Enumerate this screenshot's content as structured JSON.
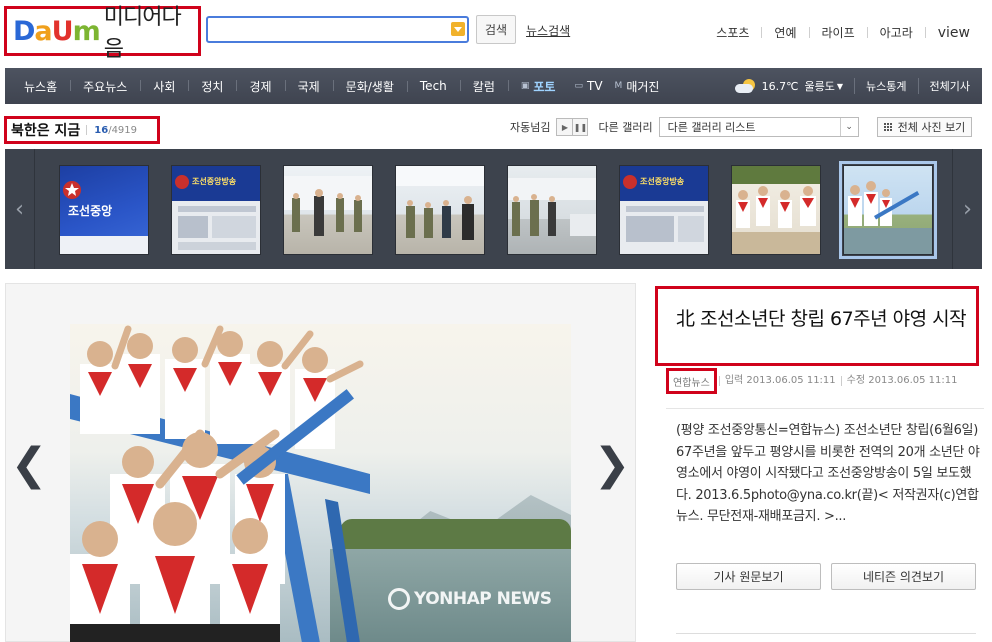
{
  "header": {
    "logo_letters": [
      "D",
      "a",
      "U",
      "m"
    ],
    "logo_text": "미디어다음",
    "search_placeholder": "",
    "search_button": "검색",
    "news_search_link": "뉴스검색",
    "top_links": [
      "스포츠",
      "연예",
      "라이프",
      "아고라",
      "view"
    ]
  },
  "nav": {
    "items": [
      "뉴스홈",
      "주요뉴스",
      "사회",
      "정치",
      "경제",
      "국제",
      "문화/생활",
      "Tech",
      "칼럼"
    ],
    "sub_items": [
      {
        "label": "포토",
        "icon": "camera-icon",
        "active": true
      },
      {
        "label": "TV",
        "icon": "tv-icon",
        "active": false
      },
      {
        "label": "매거진",
        "icon": "magazine-icon",
        "active": false
      }
    ],
    "weather": {
      "temp": "16.7℃",
      "region": "울릉도",
      "icon": "partly-cloudy-icon"
    },
    "right_links": [
      "뉴스통계",
      "전체기사"
    ]
  },
  "section": {
    "title": "북한은 지금",
    "current": "16",
    "total": "/4919"
  },
  "toolbar": {
    "autoplay_label": "자동넘김",
    "gallery_label": "다른 갤러리",
    "gallery_select_value": "다른 갤러리 리스트",
    "all_photos_button": "전체 사진 보기"
  },
  "thumbnails": [
    {
      "scene": "tv-blue",
      "caption": "조선중앙"
    },
    {
      "scene": "tv-web",
      "caption": "조선중앙방송"
    },
    {
      "scene": "factory",
      "caption": ""
    },
    {
      "scene": "factory",
      "caption": ""
    },
    {
      "scene": "lab",
      "caption": ""
    },
    {
      "scene": "tv-web",
      "caption": "조선중앙방송"
    },
    {
      "scene": "kids",
      "caption": ""
    },
    {
      "scene": "kids2",
      "caption": "",
      "selected": true
    }
  ],
  "photo": {
    "watermark": "YONHAP NEWS"
  },
  "article": {
    "title": "北 조선소년단 창립 67주년 야영 시작",
    "source": "연합뉴스",
    "input_time": "입력 2013.06.05 11:11",
    "edit_time": "수정 2013.06.05 11:11",
    "body": "(평양 조선중앙통신=연합뉴스) 조선소년단 창립(6월6일) 67주년을 앞두고 평양시를 비롯한 전역의 20개 소년단 야영소에서 야영이 시작됐다고 조선중앙방송이 5일 보도했다. 2013.6.5photo@yna.co.kr(끝)< 저작권자(c)연합뉴스. 무단전재-재배포금지. >...",
    "buttons": [
      "기사 원문보기",
      "네티즌 의견보기"
    ]
  },
  "colors": {
    "nav_bg": "#444a55",
    "highlight_red": "#d0021b",
    "search_border": "#4a7cdc",
    "active_nav": "#9fd3ff"
  }
}
